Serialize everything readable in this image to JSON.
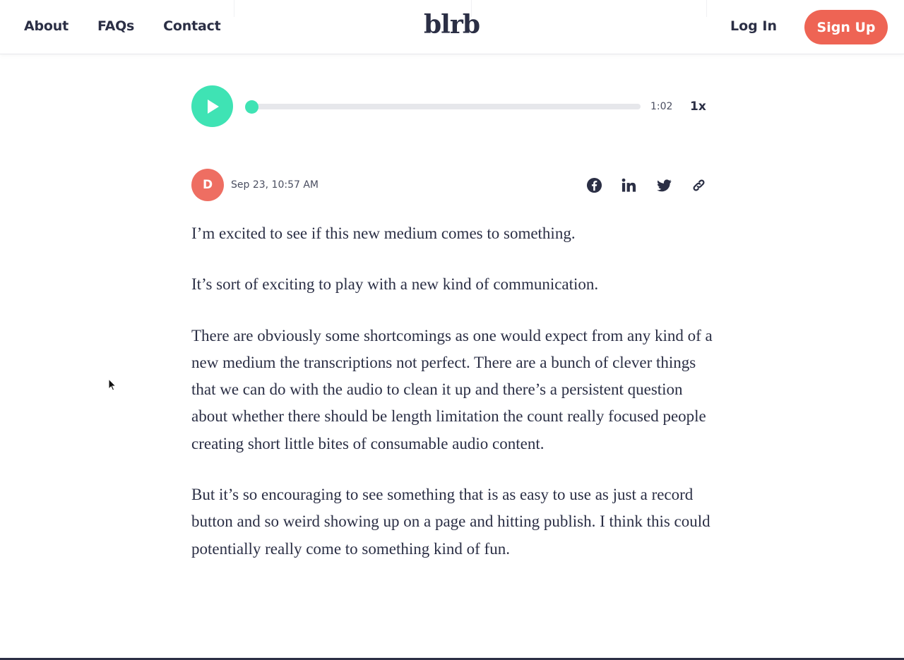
{
  "nav": {
    "links": [
      "About",
      "FAQs",
      "Contact"
    ],
    "logo": "blrb",
    "login": "Log In",
    "signup": "Sign Up"
  },
  "player": {
    "time": "1:02",
    "speed": "1x",
    "progress": 0.01
  },
  "post": {
    "avatar_initial": "D",
    "date": "Sep 23, 10:57 AM",
    "paragraphs": [
      "I’m excited to see if this new medium comes to something.",
      "It’s sort of exciting to play with a new kind of communication.",
      "There are obviously some shortcomings as one would expect from any kind of a new medium the transcriptions not perfect.  There are a bunch of clever things that we can do with the audio to clean it up and there’s a persistent question about whether there should be length limitation the count really focused people creating short little bites of consumable audio content.",
      "But it’s so encouraging to see something that is as easy to use as just a record button and so weird showing up on a page and hitting publish.  I think this could potentially really come to something kind of fun."
    ]
  },
  "share_icons": [
    "facebook-icon",
    "linkedin-icon",
    "twitter-icon",
    "link-icon"
  ],
  "colors": {
    "accent": "#3fe3b4",
    "brand": "#ee6454",
    "text": "#2b2f45"
  }
}
